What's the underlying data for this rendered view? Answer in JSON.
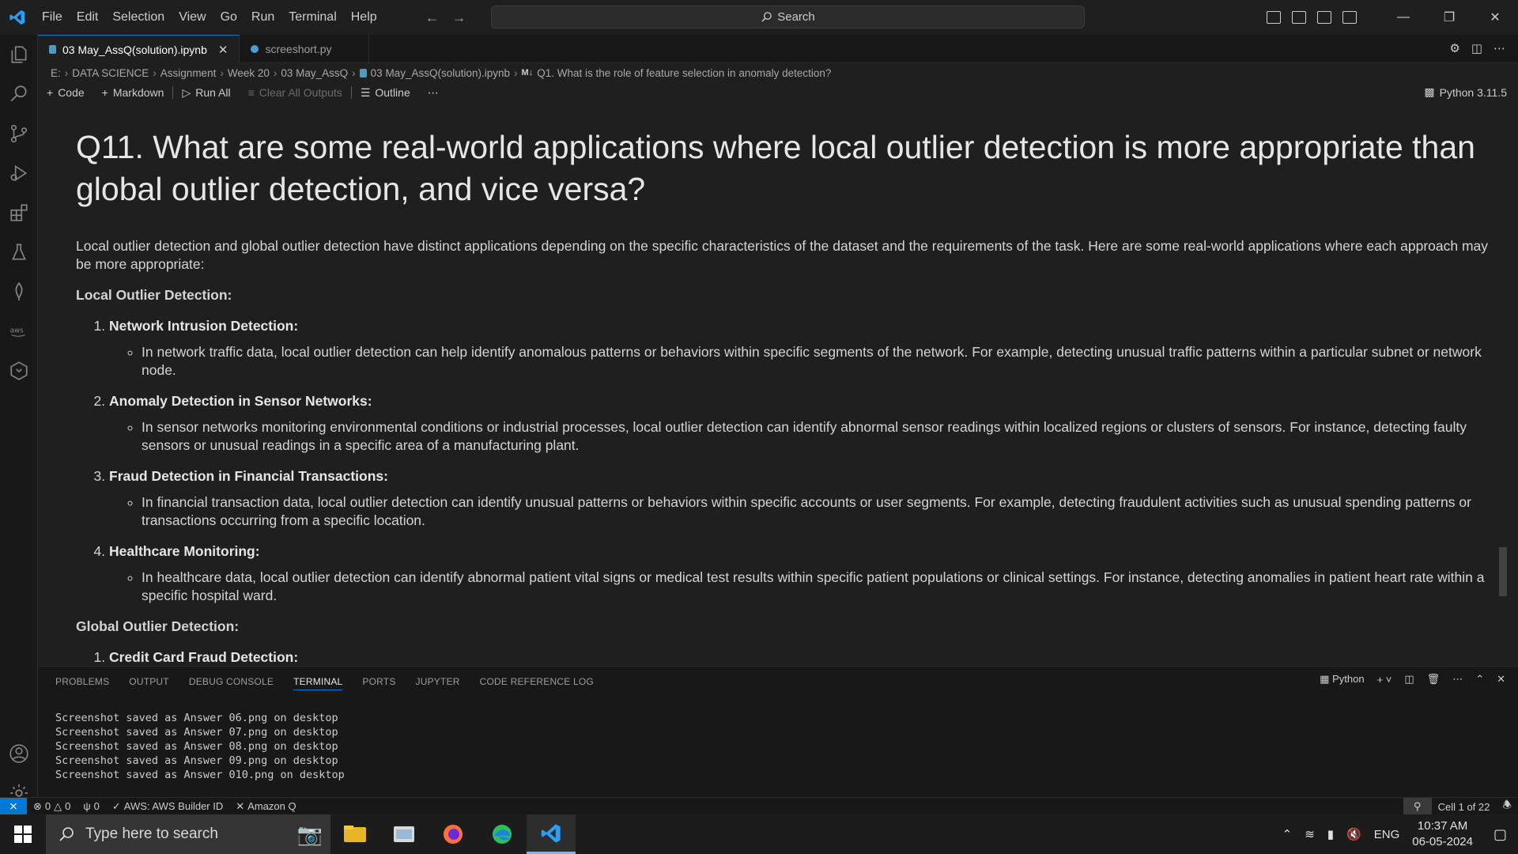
{
  "titlebar": {
    "menu": [
      "File",
      "Edit",
      "Selection",
      "View",
      "Go",
      "Run",
      "Terminal",
      "Help"
    ],
    "search_placeholder": "Search"
  },
  "tabs": [
    {
      "label": "03 May_AssQ(solution).ipynb",
      "active": true
    },
    {
      "label": "screeshort.py",
      "active": false
    }
  ],
  "breadcrumb": [
    "E:",
    "DATA SCIENCE",
    "Assignment",
    "Week 20",
    "03 May_AssQ",
    "03 May_AssQ(solution).ipynb",
    "Q1. What is the role of feature selection in anomaly detection?"
  ],
  "notebook_toolbar": {
    "code": "Code",
    "markdown": "Markdown",
    "run_all": "Run All",
    "clear_outputs": "Clear All Outputs",
    "outline": "Outline",
    "kernel": "Python 3.11.5"
  },
  "cell": {
    "heading": "Q11. What are some real-world applications where local outlier detection is more appropriate than global outlier detection, and vice versa?",
    "intro": "Local outlier detection and global outlier detection have distinct applications depending on the specific characteristics of the dataset and the requirements of the task. Here are some real-world applications where each approach may be more appropriate:",
    "local_title": "Local Outlier Detection:",
    "local_items": [
      {
        "title": "Network Intrusion Detection:",
        "detail": "In network traffic data, local outlier detection can help identify anomalous patterns or behaviors within specific segments of the network. For example, detecting unusual traffic patterns within a particular subnet or network node."
      },
      {
        "title": "Anomaly Detection in Sensor Networks:",
        "detail": "In sensor networks monitoring environmental conditions or industrial processes, local outlier detection can identify abnormal sensor readings within localized regions or clusters of sensors. For instance, detecting faulty sensors or unusual readings in a specific area of a manufacturing plant."
      },
      {
        "title": "Fraud Detection in Financial Transactions:",
        "detail": "In financial transaction data, local outlier detection can identify unusual patterns or behaviors within specific accounts or user segments. For example, detecting fraudulent activities such as unusual spending patterns or transactions occurring from a specific location."
      },
      {
        "title": "Healthcare Monitoring:",
        "detail": "In healthcare data, local outlier detection can identify abnormal patient vital signs or medical test results within specific patient populations or clinical settings. For instance, detecting anomalies in patient heart rate within a specific hospital ward."
      }
    ],
    "global_title": "Global Outlier Detection:",
    "global_items": [
      {
        "title": "Credit Card Fraud Detection:"
      }
    ]
  },
  "panel": {
    "tabs": [
      "PROBLEMS",
      "OUTPUT",
      "DEBUG CONSOLE",
      "TERMINAL",
      "PORTS",
      "JUPYTER",
      "CODE REFERENCE LOG"
    ],
    "active_tab": "TERMINAL",
    "shell": "Python",
    "terminal_lines": [
      "Screenshot saved as Answer 06.png on desktop",
      "Screenshot saved as Answer 07.png on desktop",
      "Screenshot saved as Answer 08.png on desktop",
      "Screenshot saved as Answer 09.png on desktop",
      "Screenshot saved as Answer 010.png on desktop"
    ]
  },
  "statusbar": {
    "errors": "0",
    "warnings": "0",
    "ports": "0",
    "aws": "AWS: AWS Builder ID",
    "amazonq": "Amazon Q",
    "cell": "Cell 1 of 22"
  },
  "taskbar": {
    "search_placeholder": "Type here to search",
    "lang": "ENG",
    "time": "10:37 AM",
    "date": "06-05-2024"
  },
  "colors": {
    "accent": "#0078d4",
    "background": "#1f1f1f",
    "sidebar": "#181818"
  }
}
